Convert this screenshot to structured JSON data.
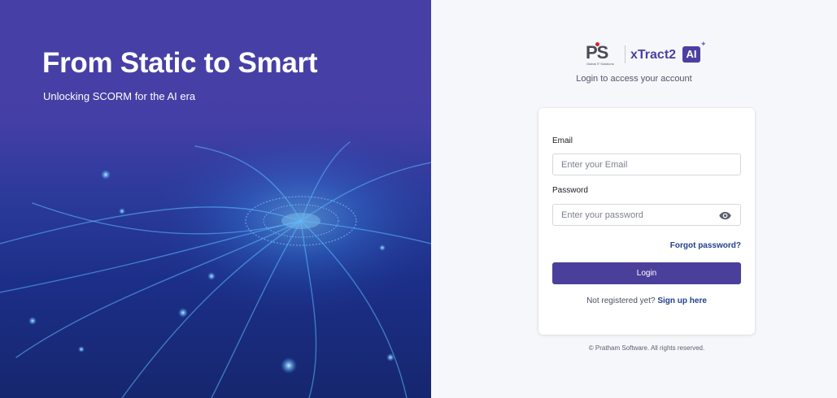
{
  "hero": {
    "title": "From Static to Smart",
    "subtitle": "Unlocking SCORM for the AI era"
  },
  "brand": {
    "ps_letters": "PS",
    "ps_tagline": "Global IT Solutions",
    "product_name": "xTract2",
    "ai_badge": "AI",
    "accent_color": "#4b3fa0"
  },
  "login": {
    "tagline": "Login to access your account",
    "email_label": "Email",
    "email_placeholder": "Enter your Email",
    "password_label": "Password",
    "password_placeholder": "Enter your password",
    "forgot_password": "Forgot password?",
    "login_button": "Login",
    "signup_prompt": "Not registered yet?",
    "signup_link": "Sign up here",
    "button_color": "#4b3f9c",
    "link_color": "#23408e"
  },
  "footer": {
    "copyright": "© Pratham Software. All rights reserved."
  }
}
